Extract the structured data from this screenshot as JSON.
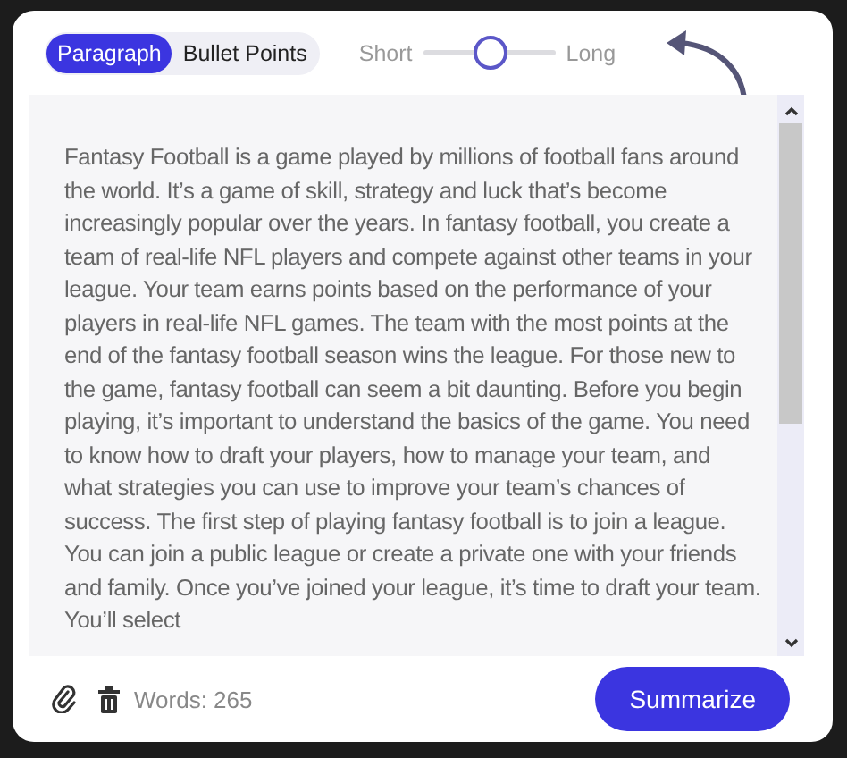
{
  "modes": [
    {
      "label": "Paragraph",
      "selected": true
    },
    {
      "label": "Bullet Points",
      "selected": false
    }
  ],
  "length": {
    "min_label": "Short",
    "max_label": "Long",
    "level": 0.5
  },
  "text": "Fantasy Football is a game played by millions of football fans around the world. It’s a game of skill, strategy and luck that’s become increasingly popular over the years. In fantasy football, you create a team of real-life NFL players and compete against other teams in your league. Your team earns points based on the performance of your players in real-life NFL games. The team with the most points at the end of the fantasy football season wins the league. For those new to the game, fantasy football can seem a bit daunting. Before you begin playing, it’s important to understand the basics of the game. You need to know how to draft your players, how to manage your team, and what strategies you can use to improve your team’s chances of success. The first step of playing fantasy football is to join a league. You can join a public league or create a private one with your friends and family. Once you’ve joined your league, it’s time to draft your team. You’ll select",
  "word_count": "Words: 265",
  "action": "Summarize"
}
